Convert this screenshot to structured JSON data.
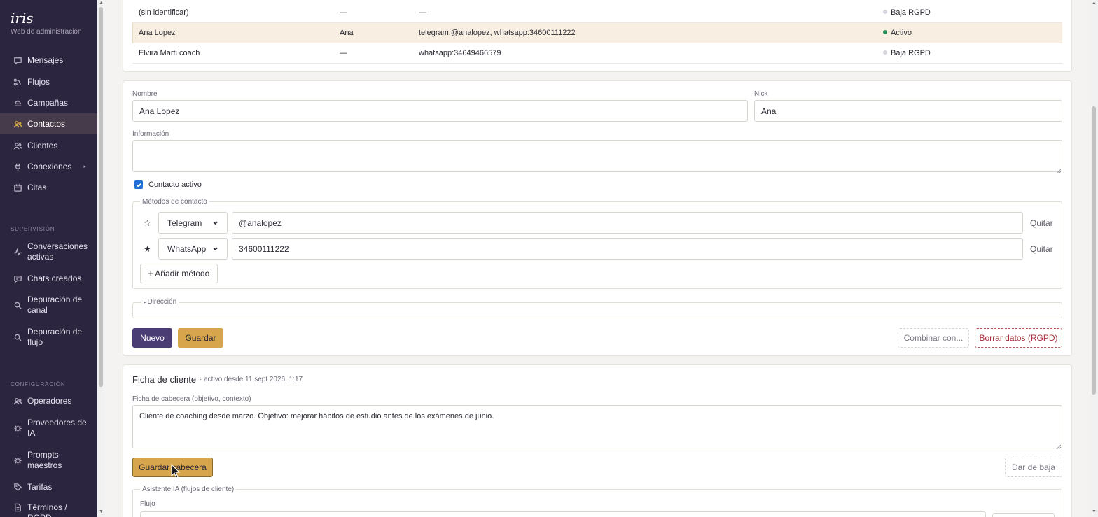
{
  "brand": {
    "title": "iris",
    "subtitle": "Web de administración"
  },
  "nav": {
    "mensajes": "Mensajes",
    "flujos": "Flujos",
    "campanas": "Campañas",
    "contactos": "Contactos",
    "clientes": "Clientes",
    "conexiones": "Conexiones",
    "citas": "Citas",
    "supervision_title": "SUPERVISIÓN",
    "conversaciones": "Conversaciones activas",
    "chats": "Chats creados",
    "dep_canal": "Depuración de canal",
    "dep_flujo": "Depuración de flujo",
    "config_title": "CONFIGURACIÓN",
    "operadores": "Operadores",
    "proveedores": "Proveedores de IA",
    "prompts": "Prompts maestros",
    "tarifas": "Tarifas",
    "terminos": "Términos / RGPD"
  },
  "contacts_table": {
    "rows": [
      {
        "name": "(sin identificar)",
        "nick": "—",
        "methods": "—",
        "status": "Baja RGPD"
      },
      {
        "name": "Ana Lopez",
        "nick": "Ana",
        "methods": "telegram:@analopez, whatsapp:34600111222",
        "status": "Activo"
      },
      {
        "name": "Elvira Marti coach",
        "nick": "—",
        "methods": "whatsapp:34649466579",
        "status": "Baja RGPD"
      }
    ]
  },
  "contact_form": {
    "nombre_label": "Nombre",
    "nombre_value": "Ana Lopez",
    "nick_label": "Nick",
    "nick_value": "Ana",
    "info_label": "Información",
    "info_value": "",
    "activo_label": "Contacto activo",
    "metodos_legend": "Métodos de contacto",
    "methods": [
      {
        "star": "☆",
        "type": "Telegram",
        "value": "@analopez",
        "remove": "Quitar"
      },
      {
        "star": "★",
        "type": "WhatsApp",
        "value": "34600111222",
        "remove": "Quitar"
      }
    ],
    "add_method": "+ Añadir método",
    "direccion": "Dirección",
    "nuevo": "Nuevo",
    "guardar": "Guardar",
    "combinar": "Combinar con...",
    "borrar": "Borrar datos (RGPD)"
  },
  "client_card": {
    "title": "Ficha de cliente",
    "since": "· activo desde 11 sept 2026, 1:17",
    "cabecera_label": "Ficha de cabecera (objetivo, contexto)",
    "cabecera_value": "Cliente de coaching desde marzo. Objetivo: mejorar hábitos de estudio antes de los exámenes de junio.",
    "guardar_cabecera": "Guardar cabecera",
    "dar_baja": "Dar de baja",
    "asistente_legend": "Asistente IA (flujos de cliente)",
    "flujo_label": "Flujo"
  },
  "colors": {
    "sidebar_bg": "#2c2540",
    "accent_gold": "#d6a54c",
    "primary": "#4a3d74",
    "status_active": "#2e8b57",
    "status_baja": "#d9d5de",
    "danger": "#a8323c"
  }
}
